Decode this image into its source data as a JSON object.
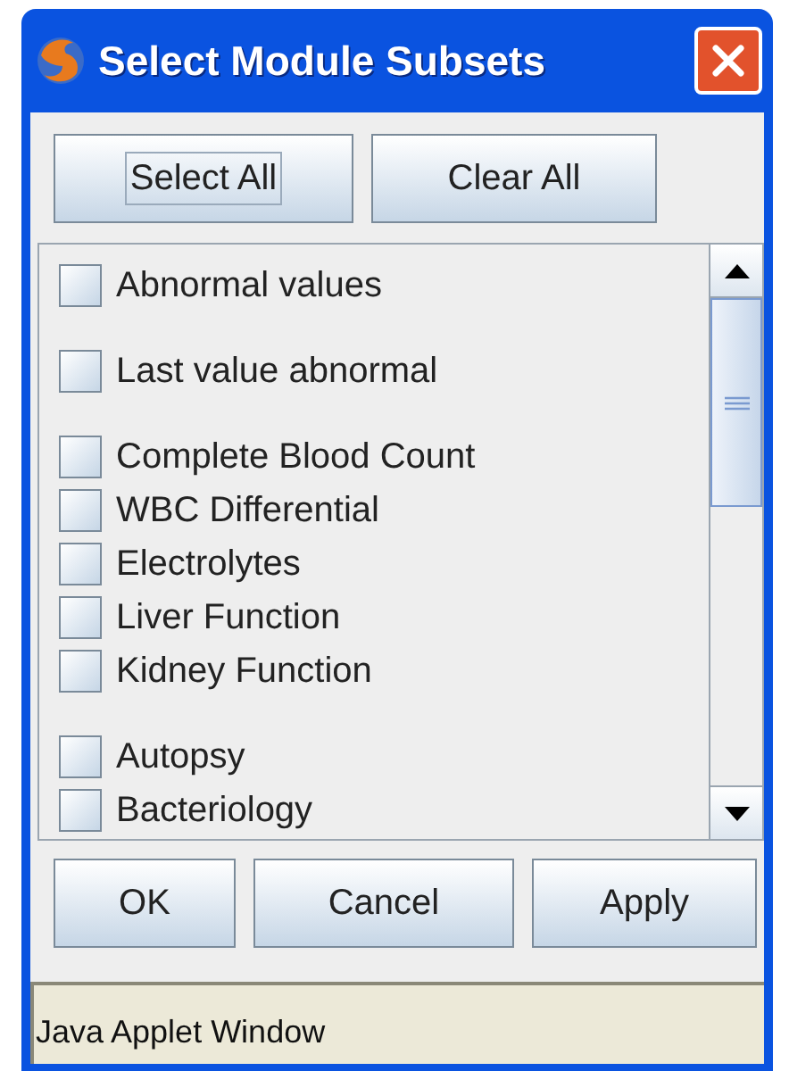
{
  "window": {
    "title": "Select Module Subsets"
  },
  "top_buttons": [
    {
      "label": "Select All",
      "focused": true
    },
    {
      "label": "Clear All",
      "focused": false
    }
  ],
  "groups": [
    {
      "items": [
        {
          "label": "Abnormal values",
          "checked": false
        }
      ]
    },
    {
      "items": [
        {
          "label": "Last value abnormal",
          "checked": false
        }
      ]
    },
    {
      "items": [
        {
          "label": "Complete Blood Count",
          "checked": false
        },
        {
          "label": "WBC Differential",
          "checked": false
        },
        {
          "label": "Electrolytes",
          "checked": false
        },
        {
          "label": "Liver Function",
          "checked": false
        },
        {
          "label": "Kidney Function",
          "checked": false
        }
      ]
    },
    {
      "items": [
        {
          "label": "Autopsy",
          "checked": false
        },
        {
          "label": "Bacteriology",
          "checked": false
        }
      ]
    }
  ],
  "bottom_buttons": [
    "OK",
    "Cancel",
    "Apply"
  ],
  "status_bar": "Java Applet Window"
}
